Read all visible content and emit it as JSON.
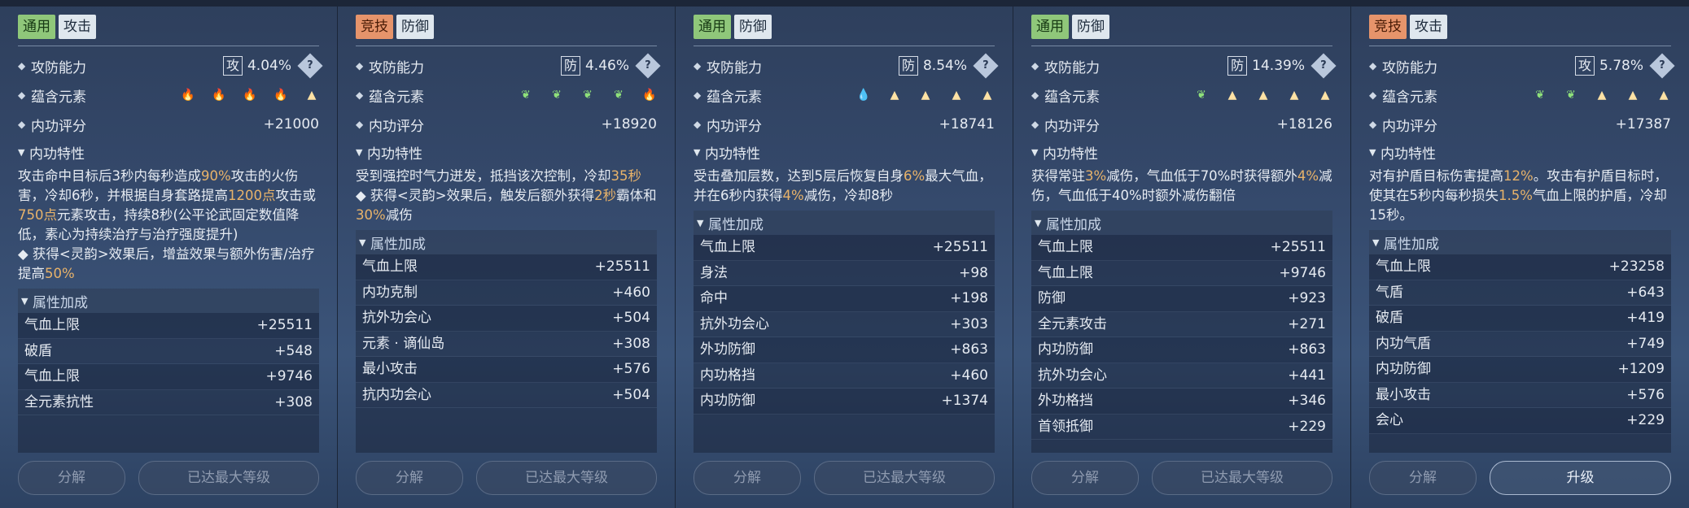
{
  "panels": [
    {
      "tags": [
        {
          "text": "通用",
          "style": "green"
        },
        {
          "text": "攻击",
          "style": "light"
        }
      ],
      "ability": {
        "label": "攻防能力",
        "box": "攻",
        "value": "4.04%"
      },
      "elements_label": "蕴含元素",
      "elements": [
        "fire",
        "fire",
        "fire",
        "fire",
        "earth"
      ],
      "score": {
        "label": "内功评分",
        "value": "+21000"
      },
      "trait_title": "内功特性",
      "desc": [
        [
          {
            "t": "攻击命中目标后3秒内每秒造成"
          },
          {
            "t": "90%",
            "h": true
          },
          {
            "t": "攻击的火伤害，冷却6秒，并根据自身套路提高"
          },
          {
            "t": "1200点",
            "h": true
          },
          {
            "t": "攻击或"
          },
          {
            "t": "750点",
            "h": true
          },
          {
            "t": "元素攻击，持续8秒(公平论武固定数值降低，素心为持续治疗与治疗强度提升)"
          }
        ],
        [
          {
            "t": "◆ 获得<灵韵>效果后，增益效果与额外伤害/治疗提高"
          },
          {
            "t": "50%",
            "h": true
          }
        ]
      ],
      "attr_title": "属性加成",
      "attrs": [
        [
          "气血上限",
          "+25511"
        ],
        [
          "破盾",
          "+548"
        ],
        [
          "气血上限",
          "+9746"
        ],
        [
          "全元素抗性",
          "+308"
        ]
      ],
      "btn_left": "分解",
      "btn_right": "已达最大等级",
      "btn_right_active": false
    },
    {
      "tags": [
        {
          "text": "竞技",
          "style": "orange"
        },
        {
          "text": "防御",
          "style": "light"
        }
      ],
      "ability": {
        "label": "攻防能力",
        "box": "防",
        "value": "4.46%"
      },
      "elements_label": "蕴含元素",
      "elements": [
        "wood",
        "wood",
        "wood",
        "wood",
        "fire"
      ],
      "score": {
        "label": "内功评分",
        "value": "+18920"
      },
      "trait_title": "内功特性",
      "desc": [
        [
          {
            "t": "受到强控时气力迸发，抵挡该次控制，冷却"
          },
          {
            "t": "35秒",
            "h": true
          }
        ],
        [
          {
            "t": "◆ 获得<灵韵>效果后，触发后额外获得"
          },
          {
            "t": "2秒",
            "h": true
          },
          {
            "t": "霸体和"
          },
          {
            "t": "30%",
            "h": true
          },
          {
            "t": "减伤"
          }
        ]
      ],
      "attr_title": "属性加成",
      "attrs": [
        [
          "气血上限",
          "+25511"
        ],
        [
          "内功克制",
          "+460"
        ],
        [
          "抗外功会心",
          "+504"
        ],
        [
          "元素 · 谪仙岛",
          "+308"
        ],
        [
          "最小攻击",
          "+576"
        ],
        [
          "抗内功会心",
          "+504"
        ]
      ],
      "btn_left": "分解",
      "btn_right": "已达最大等级",
      "btn_right_active": false
    },
    {
      "tags": [
        {
          "text": "通用",
          "style": "green"
        },
        {
          "text": "防御",
          "style": "light"
        }
      ],
      "ability": {
        "label": "攻防能力",
        "box": "防",
        "value": "8.54%"
      },
      "elements_label": "蕴含元素",
      "elements": [
        "water",
        "earth",
        "earth",
        "earth",
        "earth"
      ],
      "score": {
        "label": "内功评分",
        "value": "+18741"
      },
      "trait_title": "内功特性",
      "desc": [
        [
          {
            "t": "受击叠加层数，达到5层后恢复自身"
          },
          {
            "t": "6%",
            "h": true
          },
          {
            "t": "最大气血，并在6秒内获得"
          },
          {
            "t": "4%",
            "h": true
          },
          {
            "t": "减伤，冷却8秒"
          }
        ]
      ],
      "attr_title": "属性加成",
      "attrs": [
        [
          "气血上限",
          "+25511"
        ],
        [
          "身法",
          "+98"
        ],
        [
          "命中",
          "+198"
        ],
        [
          "抗外功会心",
          "+303"
        ],
        [
          "外功防御",
          "+863"
        ],
        [
          "内功格挡",
          "+460"
        ],
        [
          "内功防御",
          "+1374"
        ]
      ],
      "btn_left": "分解",
      "btn_right": "已达最大等级",
      "btn_right_active": false
    },
    {
      "tags": [
        {
          "text": "通用",
          "style": "green"
        },
        {
          "text": "防御",
          "style": "light"
        }
      ],
      "ability": {
        "label": "攻防能力",
        "box": "防",
        "value": "14.39%"
      },
      "elements_label": "蕴含元素",
      "elements": [
        "wood",
        "earth",
        "earth",
        "earth",
        "earth"
      ],
      "score": {
        "label": "内功评分",
        "value": "+18126"
      },
      "trait_title": "内功特性",
      "desc": [
        [
          {
            "t": "获得常驻"
          },
          {
            "t": "3%",
            "h": true
          },
          {
            "t": "减伤，气血低于70%时获得额外"
          },
          {
            "t": "4%",
            "h": true
          },
          {
            "t": "减伤，气血低于40%时额外减伤翻倍"
          }
        ]
      ],
      "attr_title": "属性加成",
      "attrs": [
        [
          "气血上限",
          "+25511"
        ],
        [
          "气血上限",
          "+9746"
        ],
        [
          "防御",
          "+923"
        ],
        [
          "全元素攻击",
          "+271"
        ],
        [
          "内功防御",
          "+863"
        ],
        [
          "抗外功会心",
          "+441"
        ],
        [
          "外功格挡",
          "+346"
        ],
        [
          "首领抵御",
          "+229"
        ]
      ],
      "btn_left": "分解",
      "btn_right": "已达最大等级",
      "btn_right_active": false
    },
    {
      "tags": [
        {
          "text": "竞技",
          "style": "orange"
        },
        {
          "text": "攻击",
          "style": "light"
        }
      ],
      "ability": {
        "label": "攻防能力",
        "box": "攻",
        "value": "5.78%"
      },
      "elements_label": "蕴含元素",
      "elements": [
        "wood",
        "wood",
        "earth",
        "earth",
        "earth"
      ],
      "score": {
        "label": "内功评分",
        "value": "+17387"
      },
      "trait_title": "内功特性",
      "desc": [
        [
          {
            "t": "对有护盾目标伤害提高"
          },
          {
            "t": "12%",
            "h": true
          },
          {
            "t": "。攻击有护盾目标时，使其在5秒内每秒损失"
          },
          {
            "t": "1.5%",
            "h": true
          },
          {
            "t": "气血上限的护盾，冷却15秒。"
          }
        ]
      ],
      "attr_title": "属性加成",
      "attrs": [
        [
          "气血上限",
          "+23258"
        ],
        [
          "气盾",
          "+643"
        ],
        [
          "破盾",
          "+419"
        ],
        [
          "内功气盾",
          "+749"
        ],
        [
          "内功防御",
          "+1209"
        ],
        [
          "最小攻击",
          "+576"
        ],
        [
          "会心",
          "+229"
        ]
      ],
      "btn_left": "分解",
      "btn_right": "升级",
      "btn_right_active": true
    }
  ]
}
